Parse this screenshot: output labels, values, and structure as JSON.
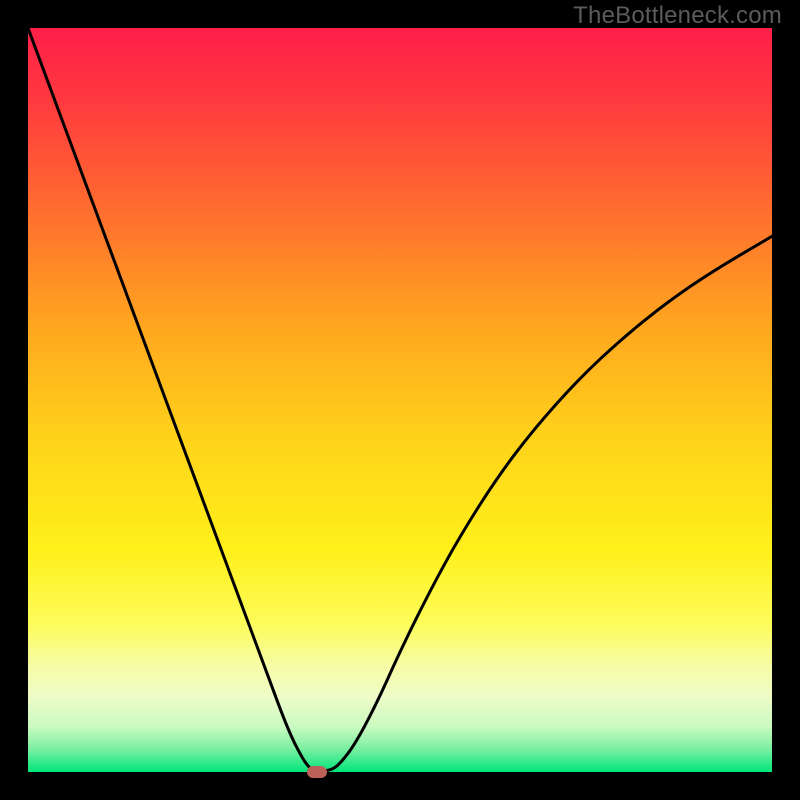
{
  "watermark": "TheBottleneck.com",
  "chart_data": {
    "type": "line",
    "title": "",
    "xlabel": "",
    "ylabel": "",
    "xlim": [
      0,
      100
    ],
    "ylim": [
      0,
      100
    ],
    "background_gradient": {
      "stops": [
        {
          "offset": 0.0,
          "color": "#ff1f49"
        },
        {
          "offset": 0.1,
          "color": "#ff3a3f"
        },
        {
          "offset": 0.25,
          "color": "#ff6f2e"
        },
        {
          "offset": 0.4,
          "color": "#ffa61f"
        },
        {
          "offset": 0.55,
          "color": "#ffd21a"
        },
        {
          "offset": 0.7,
          "color": "#fff01a"
        },
        {
          "offset": 0.8,
          "color": "#fdfc5a"
        },
        {
          "offset": 0.86,
          "color": "#f6fca8"
        },
        {
          "offset": 0.9,
          "color": "#eefcc8"
        },
        {
          "offset": 0.94,
          "color": "#c8fac0"
        },
        {
          "offset": 0.97,
          "color": "#77efa0"
        },
        {
          "offset": 1.0,
          "color": "#00e57a"
        }
      ]
    },
    "series": [
      {
        "name": "bottleneck-curve",
        "x": [
          0,
          4,
          8,
          12,
          16,
          20,
          24,
          28,
          32,
          35,
          37,
          38,
          38.5,
          39,
          40,
          41,
          42,
          44,
          47,
          50,
          54,
          58,
          63,
          68,
          74,
          80,
          86,
          92,
          100
        ],
        "y": [
          100,
          89.2,
          78.4,
          67.6,
          56.8,
          46.0,
          35.2,
          24.4,
          13.6,
          5.5,
          1.6,
          0.4,
          0.1,
          0.1,
          0.15,
          0.4,
          1.2,
          3.8,
          9.5,
          16.2,
          24.3,
          31.6,
          39.5,
          46.1,
          52.8,
          58.4,
          63.2,
          67.3,
          72.0
        ]
      }
    ],
    "marker": {
      "x": 38.8,
      "y": 0.0,
      "color": "#bb6158"
    }
  }
}
